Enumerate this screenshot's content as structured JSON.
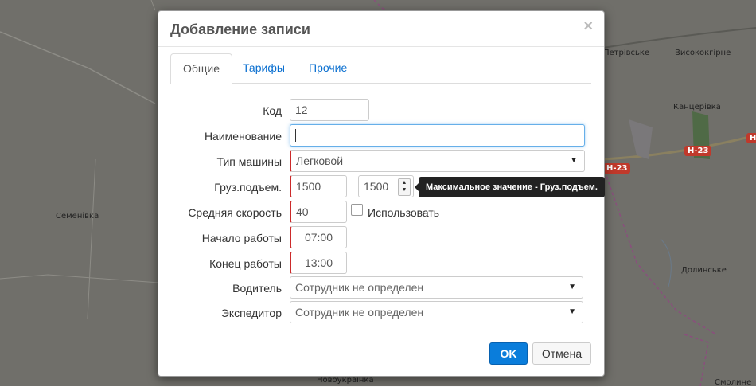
{
  "map": {
    "labels": [
      "Петрівське",
      "Висококгірне",
      "Канцерівка",
      "Семенівка",
      "Долинське",
      "Новоукраїнка",
      "Смолине"
    ],
    "roads": [
      "H-23",
      "H-23",
      "H"
    ]
  },
  "dialog": {
    "title": "Добавление записи",
    "close_glyph": "×",
    "tabs": [
      "Общие",
      "Тарифы",
      "Прочие"
    ],
    "active_tab": "Общие",
    "fields": {
      "code": {
        "label": "Код",
        "value": "12"
      },
      "name": {
        "label": "Наименование",
        "value": ""
      },
      "vehicle_type": {
        "label": "Тип машины",
        "value": "Легковой"
      },
      "capacity": {
        "label": "Груз.подъем.",
        "value": "1500",
        "max_value": "1500",
        "tooltip": "Максимальное значение - Груз.подъем."
      },
      "avg_speed": {
        "label": "Средняя скорость",
        "value": "40",
        "checkbox_label": "Использовать"
      },
      "work_start": {
        "label": "Начало работы",
        "value": "07:00"
      },
      "work_end": {
        "label": "Конец работы",
        "value": "13:00"
      },
      "driver": {
        "label": "Водитель",
        "value": "Сотрудник не определен"
      },
      "forwarder": {
        "label": "Экспедитор",
        "value": "Сотрудник не определен"
      }
    },
    "buttons": {
      "ok": "OK",
      "cancel": "Отмена"
    }
  },
  "colors": {
    "primary": "#0a7ddb",
    "required": "#cc2a2a",
    "tooltip_bg": "#222222"
  },
  "icons": {
    "dropdown": "caret-down-icon",
    "spinner": "spinner-arrows-icon",
    "close": "close-icon"
  }
}
